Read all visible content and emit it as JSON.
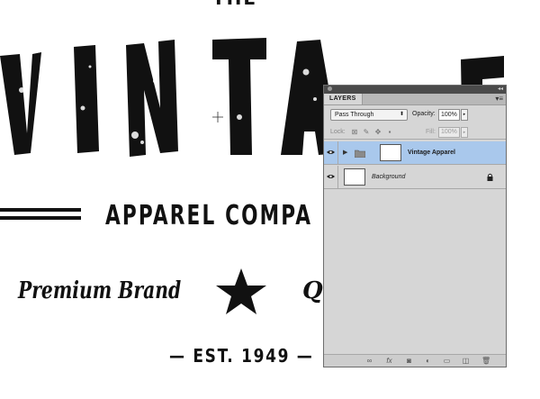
{
  "artwork": {
    "the_text": "THE",
    "vintage_text": "VINTAGE",
    "apparel_text": "APPAREL COMPA",
    "premium_text": "Premium Brand",
    "q_text": "Qu",
    "est_text": "— EST. 1949 —"
  },
  "layers_panel": {
    "tab_label": "LAYERS",
    "blend_mode": "Pass Through",
    "opacity_label": "Opacity:",
    "opacity_value": "100%",
    "lock_label": "Lock:",
    "fill_label": "Fill:",
    "fill_value": "100%",
    "layers": [
      {
        "name": "Vintage Apparel",
        "type": "group",
        "selected": true
      },
      {
        "name": "Background",
        "type": "background",
        "selected": false
      }
    ],
    "bottom_icons": [
      "link-icon",
      "fx-icon",
      "mask-icon",
      "adjustment-icon",
      "new-group-icon",
      "new-layer-icon",
      "trash-icon"
    ]
  },
  "colors": {
    "artwork": "#111111",
    "panel_bg": "#d6d6d6",
    "selection": "#a9c8ec",
    "title_bar": "#4a4a4a"
  }
}
